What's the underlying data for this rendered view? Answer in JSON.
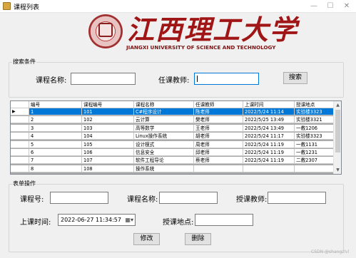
{
  "window": {
    "title": "课程列表",
    "min_glyph": "—",
    "max_glyph": "☐",
    "close_glyph": "✕"
  },
  "logo": {
    "cn": "江西理工大学",
    "en": "JIANGXI UNIVERSITY OF SCIENCE AND TECHNOLOGY"
  },
  "search": {
    "group_title": "搜索条件",
    "course_name_label": "课程名称:",
    "course_name_value": "",
    "teacher_label": "任课教师:",
    "teacher_value": "",
    "search_button": "搜索"
  },
  "grid": {
    "columns": [
      "编号",
      "课程编号",
      "课程名称",
      "任课教师",
      "上课时间",
      "授课地点"
    ],
    "row_indicator": "▶",
    "rows": [
      [
        "1",
        "101",
        "C#程序设计",
        "陈老师",
        "2022/5/24 11:14",
        "实验楼3323"
      ],
      [
        "2",
        "102",
        "云计算",
        "樊老师",
        "2022/5/25 13:49",
        "实验楼3321"
      ],
      [
        "3",
        "103",
        "高等数学",
        "王老师",
        "2022/5/24 13:49",
        "一教1206"
      ],
      [
        "4",
        "104",
        "Linux操作系统",
        "胡老师",
        "2022/5/24 11:17",
        "实验楼3323"
      ],
      [
        "5",
        "105",
        "设计模式",
        "周老师",
        "2022/5/24 11:19",
        "一教1131"
      ],
      [
        "6",
        "106",
        "信息安全",
        "邱老师",
        "2022/5/24 11:19",
        "一教1231"
      ],
      [
        "7",
        "107",
        "软件工程导论",
        "蔡老师",
        "2022/5/24 11:19",
        "二教2307"
      ],
      [
        "8",
        "108",
        "操作系统",
        "",
        "",
        ""
      ]
    ],
    "selected_row": 0,
    "scroll_up": "▲",
    "scroll_down": "▼"
  },
  "form": {
    "group_title": "表单操作",
    "course_no_label": "课程号:",
    "course_no_value": "",
    "course_name_label": "课程名称:",
    "course_name_value": "",
    "teacher_label": "授课教师:",
    "teacher_value": "",
    "time_label": "上课时间:",
    "time_value": "2022-06-27 11:34:57",
    "calendar_glyph": "▦▾",
    "place_label": "授课地点:",
    "place_value": "",
    "edit_button": "修改",
    "delete_button": "删除"
  },
  "watermark": "CSDN @shangzlvl"
}
